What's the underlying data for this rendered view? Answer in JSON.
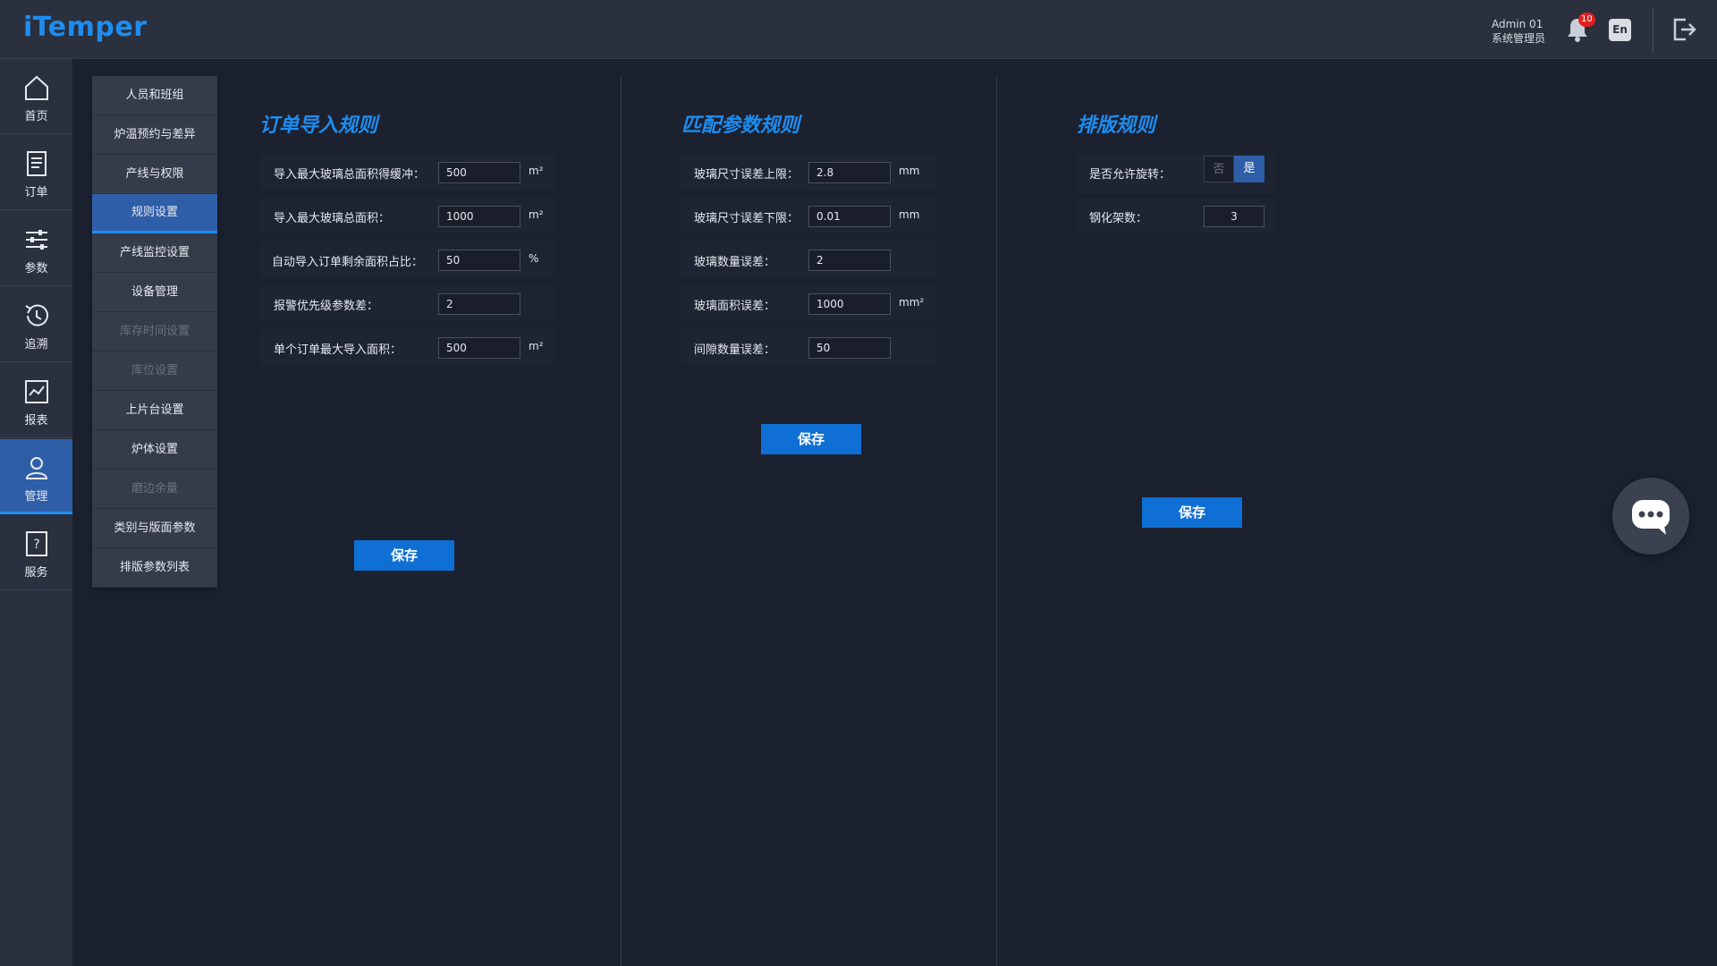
{
  "app": {
    "title": "iTemper"
  },
  "header": {
    "user_name": "Admin 01",
    "user_role": "系统管理员",
    "notification_count": "10",
    "lang_label": "En"
  },
  "rail": {
    "items": [
      {
        "label": "首页",
        "icon": "home-icon"
      },
      {
        "label": "订单",
        "icon": "order-icon"
      },
      {
        "label": "参数",
        "icon": "sliders-icon"
      },
      {
        "label": "追溯",
        "icon": "history-icon"
      },
      {
        "label": "报表",
        "icon": "report-icon"
      },
      {
        "label": "管理",
        "icon": "user-manage-icon",
        "active": true
      },
      {
        "label": "服务",
        "icon": "help-icon"
      }
    ]
  },
  "submenu": {
    "items": [
      {
        "label": "人员和班组"
      },
      {
        "label": "炉温预约与差异"
      },
      {
        "label": "产线与权限"
      },
      {
        "label": "规则设置",
        "active": true
      },
      {
        "label": "产线监控设置"
      },
      {
        "label": "设备管理"
      },
      {
        "label": "库存时间设置",
        "disabled": true
      },
      {
        "label": "库位设置",
        "disabled": true
      },
      {
        "label": "上片台设置"
      },
      {
        "label": "炉体设置"
      },
      {
        "label": "磨边余量",
        "disabled": true
      },
      {
        "label": "类别与版面参数"
      },
      {
        "label": "排版参数列表"
      }
    ]
  },
  "order_rules": {
    "title": "订单导入规则",
    "fields": [
      {
        "label": "导入最大玻璃总面积得缓冲：",
        "value": "500",
        "unit": "m²"
      },
      {
        "label": "导入最大玻璃总面积：",
        "value": "1000",
        "unit": "m²"
      },
      {
        "label": "自动导入订单剩余面积占比：",
        "value": "50",
        "unit": "%"
      },
      {
        "label": "报警优先级参数差：",
        "value": "2",
        "unit": ""
      },
      {
        "label": "单个订单最大导入面积：",
        "value": "500",
        "unit": "m²"
      }
    ],
    "save_label": "保存"
  },
  "match_rules": {
    "title": "匹配参数规则",
    "fields": [
      {
        "label": "玻璃尺寸误差上限：",
        "value": "2.8",
        "unit": "mm"
      },
      {
        "label": "玻璃尺寸误差下限：",
        "value": "0.01",
        "unit": "mm"
      },
      {
        "label": "玻璃数量误差：",
        "value": "2",
        "unit": ""
      },
      {
        "label": "玻璃面积误差：",
        "value": "1000",
        "unit": "mm²"
      },
      {
        "label": "间隙数量误差：",
        "value": "50",
        "unit": ""
      }
    ],
    "save_label": "保存"
  },
  "layout_rules": {
    "title": "排版规则",
    "rotate_label": "是否允许旋转：",
    "rotate_no": "否",
    "rotate_yes": "是",
    "rotate_selected": "是",
    "racks_label": "钢化架数：",
    "racks_value": "3",
    "save_label": "保存"
  },
  "colors": {
    "accent": "#1d8df0",
    "active_bg": "#2f5ea8",
    "save_button": "#0f6fd4",
    "background": "#1c2130"
  }
}
